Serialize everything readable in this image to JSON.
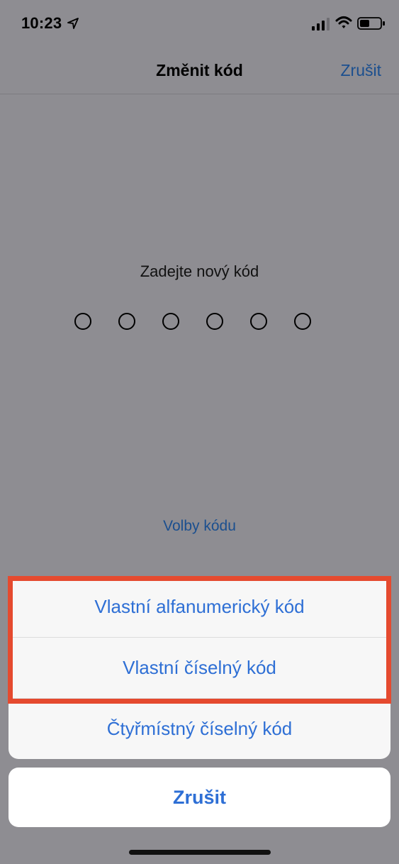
{
  "status_bar": {
    "time": "10:23",
    "icons": [
      "location-arrow-icon",
      "cellular-signal-icon",
      "wifi-icon",
      "battery-icon"
    ]
  },
  "nav": {
    "title": "Změnit kód",
    "cancel_label": "Zrušit"
  },
  "passcode": {
    "prompt": "Zadejte nový kód",
    "digit_count": 6,
    "options_link": "Volby kódu"
  },
  "action_sheet": {
    "items": [
      {
        "label": "Vlastní alfanumerický kód"
      },
      {
        "label": "Vlastní číselný kód"
      },
      {
        "label": "Čtyřmístný číselný kód"
      }
    ],
    "cancel_label": "Zrušit"
  },
  "colors": {
    "accent": "#2e6fd5",
    "highlight": "#e54a2f",
    "dim_background": "#8e8d92"
  }
}
